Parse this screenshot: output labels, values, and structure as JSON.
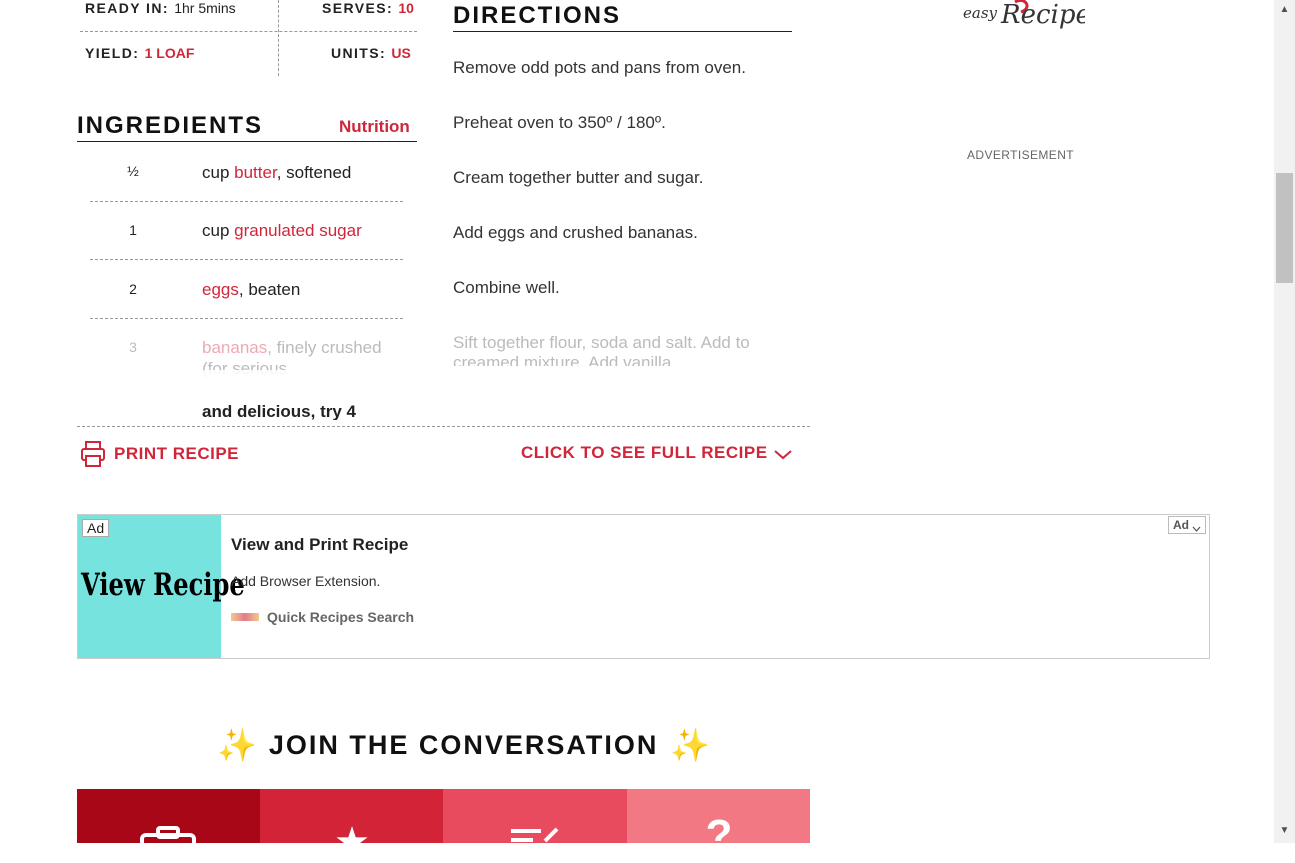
{
  "meta": {
    "ready_in_label": "READY IN:",
    "ready_in_value": "1hr 5mins",
    "serves_label": "SERVES:",
    "serves_value": "10",
    "yield_label": "YIELD:",
    "yield_value": "1 loaf",
    "units_label": "UNITS:",
    "units_value": "US"
  },
  "ingredients": {
    "title": "INGREDIENTS",
    "nutrition_link": "Nutrition",
    "items": [
      {
        "qty": "½",
        "pre": "cup ",
        "link": "butter",
        "post": ", softened"
      },
      {
        "qty": "1",
        "pre": "cup ",
        "link": "granulated sugar",
        "post": ""
      },
      {
        "qty": "2",
        "pre": "",
        "link": "eggs",
        "post": ", beaten"
      },
      {
        "qty": "3",
        "pre": "",
        "link": "bananas",
        "post": ", finely crushed (for serious"
      },
      {
        "qty": "",
        "pre": "and delicious, try 4",
        "link": "",
        "post": ""
      }
    ]
  },
  "directions": {
    "title": "DIRECTIONS",
    "steps": [
      "Remove odd pots and pans from oven.",
      "Preheat oven to 350º / 180º.",
      "Cream together butter and sugar.",
      "Add eggs and crushed bananas.",
      "Combine well.",
      "Sift together flour, soda and salt. Add to creamed mixture. Add vanilla."
    ]
  },
  "actions": {
    "print_recipe": "PRINT RECIPE",
    "full_recipe": "CLICK TO SEE FULL RECIPE"
  },
  "sidebar": {
    "logo_text_1": "easy",
    "logo_text_2": "Recipes",
    "advertisement": "ADVERTISEMENT"
  },
  "ad": {
    "badge": "Ad",
    "image_text": "View Recipe",
    "title": "View and Print Recipe",
    "description": "Add Browser Extension.",
    "source": "Quick Recipes Search",
    "choices_label": "Ad"
  },
  "conversation": {
    "title": "JOIN THE CONVERSATION",
    "sparkle": "✨",
    "tiles": [
      {
        "icon": "camera-icon",
        "color": "#a80717"
      },
      {
        "icon": "star-icon",
        "color": "#d32336"
      },
      {
        "icon": "review-icon",
        "color": "#e94b5e"
      },
      {
        "icon": "question-icon",
        "color": "#f27883"
      }
    ],
    "tile_glyphs": [
      "",
      "★",
      "",
      "?"
    ]
  },
  "colors": {
    "accent": "#d0263a",
    "ad_image_bg": "#76e3df"
  }
}
